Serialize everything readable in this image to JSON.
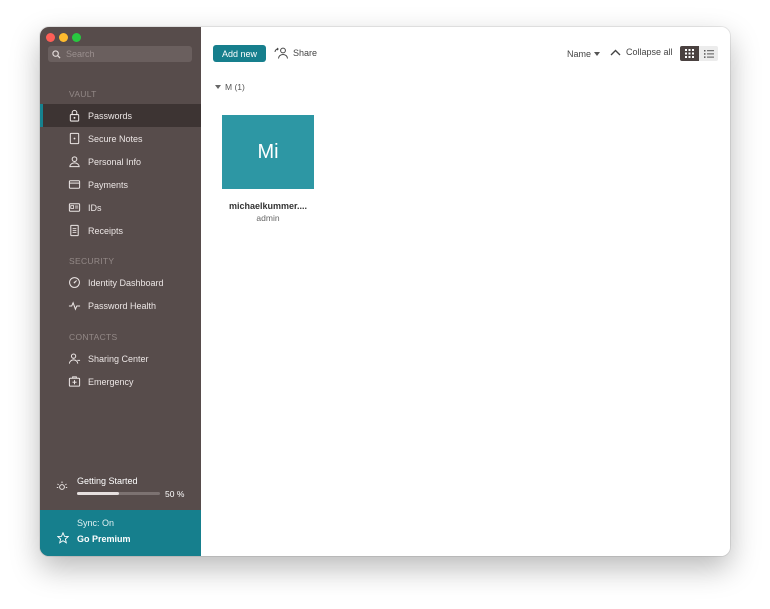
{
  "sidebar": {
    "search": {
      "placeholder": "Search"
    },
    "sections": {
      "vault": "VAULT",
      "security": "SECURITY",
      "contacts": "CONTACTS"
    },
    "items": {
      "passwords": "Passwords",
      "secure_notes": "Secure Notes",
      "personal_info": "Personal Info",
      "payments": "Payments",
      "ids": "IDs",
      "receipts": "Receipts",
      "identity_dashboard": "Identity Dashboard",
      "password_health": "Password Health",
      "sharing_center": "Sharing Center",
      "emergency": "Emergency"
    },
    "active_item": "passwords",
    "getting_started": {
      "label": "Getting Started",
      "progress": 50,
      "progress_label": "50 %"
    },
    "footer": {
      "sync": "Sync: On",
      "go_premium": "Go Premium"
    }
  },
  "toolbar": {
    "add_new": "Add new",
    "share": "Share",
    "sort": "Name",
    "collapse_all": "Collapse all",
    "view_mode": "grid"
  },
  "groups": [
    {
      "header": "M (1)",
      "items": [
        {
          "initials": "Mi",
          "title": "michaelkummer....",
          "subtitle": "admin",
          "color": "#2d97a4"
        }
      ]
    }
  ],
  "colors": {
    "sidebar_bg": "#574c4b",
    "accent": "#167f8d",
    "tile": "#2d97a4"
  }
}
